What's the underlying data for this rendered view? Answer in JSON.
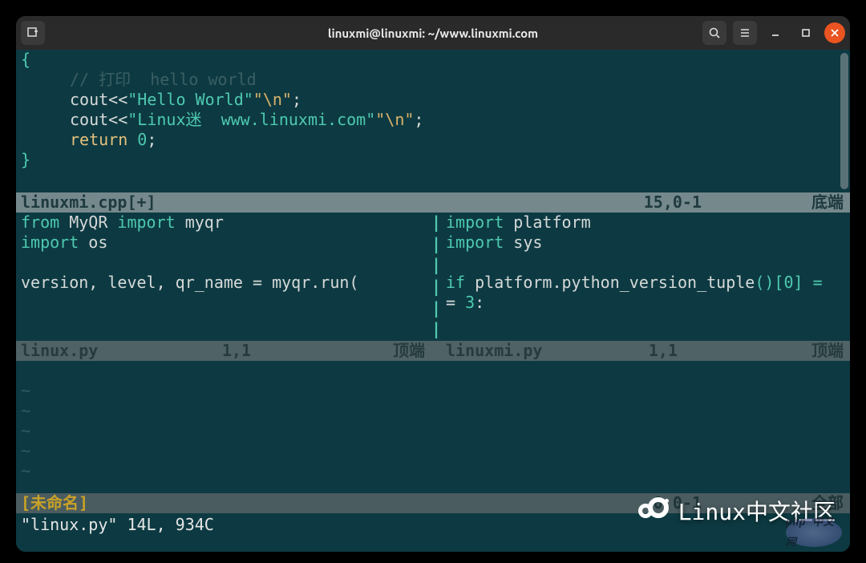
{
  "titlebar": {
    "title": "linuxmi@linuxmi: ~/www.linuxmi.com"
  },
  "top_pane": {
    "brace_open": "{",
    "comment": "// 打印  hello world",
    "line1_a": "cout<<",
    "line1_str": "\"Hello World\"",
    "line1_esc": "\"\\n\"",
    "line1_end": ";",
    "line2_a": "cout<<",
    "line2_str": "\"Linux迷  www.linuxmi.com\"",
    "line2_esc": "\"\\n\"",
    "line2_end": ";",
    "return_kw": "return",
    "return_sp": " ",
    "return_num": "0",
    "return_end": ";",
    "brace_close": "}"
  },
  "status_top": {
    "fname": "linuxmi.cpp",
    "plus": " [+]",
    "pos": "15,0-1",
    "loc": "底端"
  },
  "left_pane": {
    "l1_from": "from",
    "l1_mod": " MyQR ",
    "l1_import": "import",
    "l1_name": " myqr",
    "l2_import": "import",
    "l2_name": " os",
    "l4": "version, level, qr_name = myqr.run("
  },
  "right_pane": {
    "l1_import": "import",
    "l1_name": " platform",
    "l2_import": "import",
    "l2_name": " sys",
    "l4_if": "if",
    "l4_rest": " platform.python_version_tuple",
    "l4_par": "()[",
    "l4_idx": "0",
    "l4_close": "] =",
    "l5": "= ",
    "l5_num": "3",
    "l5_colon": ":"
  },
  "status_left": {
    "fname": "linux.py",
    "pos": "1,1",
    "loc": "顶端"
  },
  "status_right": {
    "fname": "linuxmi.py",
    "pos": "1,1",
    "loc": "顶端"
  },
  "status_bottom": {
    "fname": "[未命名]",
    "pos": "0,0-1",
    "loc": "全部"
  },
  "cmdline": "\"linux.py\" 14L, 934C",
  "watermark": {
    "text": "Linux中文社区",
    "badge": "php 中文网"
  }
}
